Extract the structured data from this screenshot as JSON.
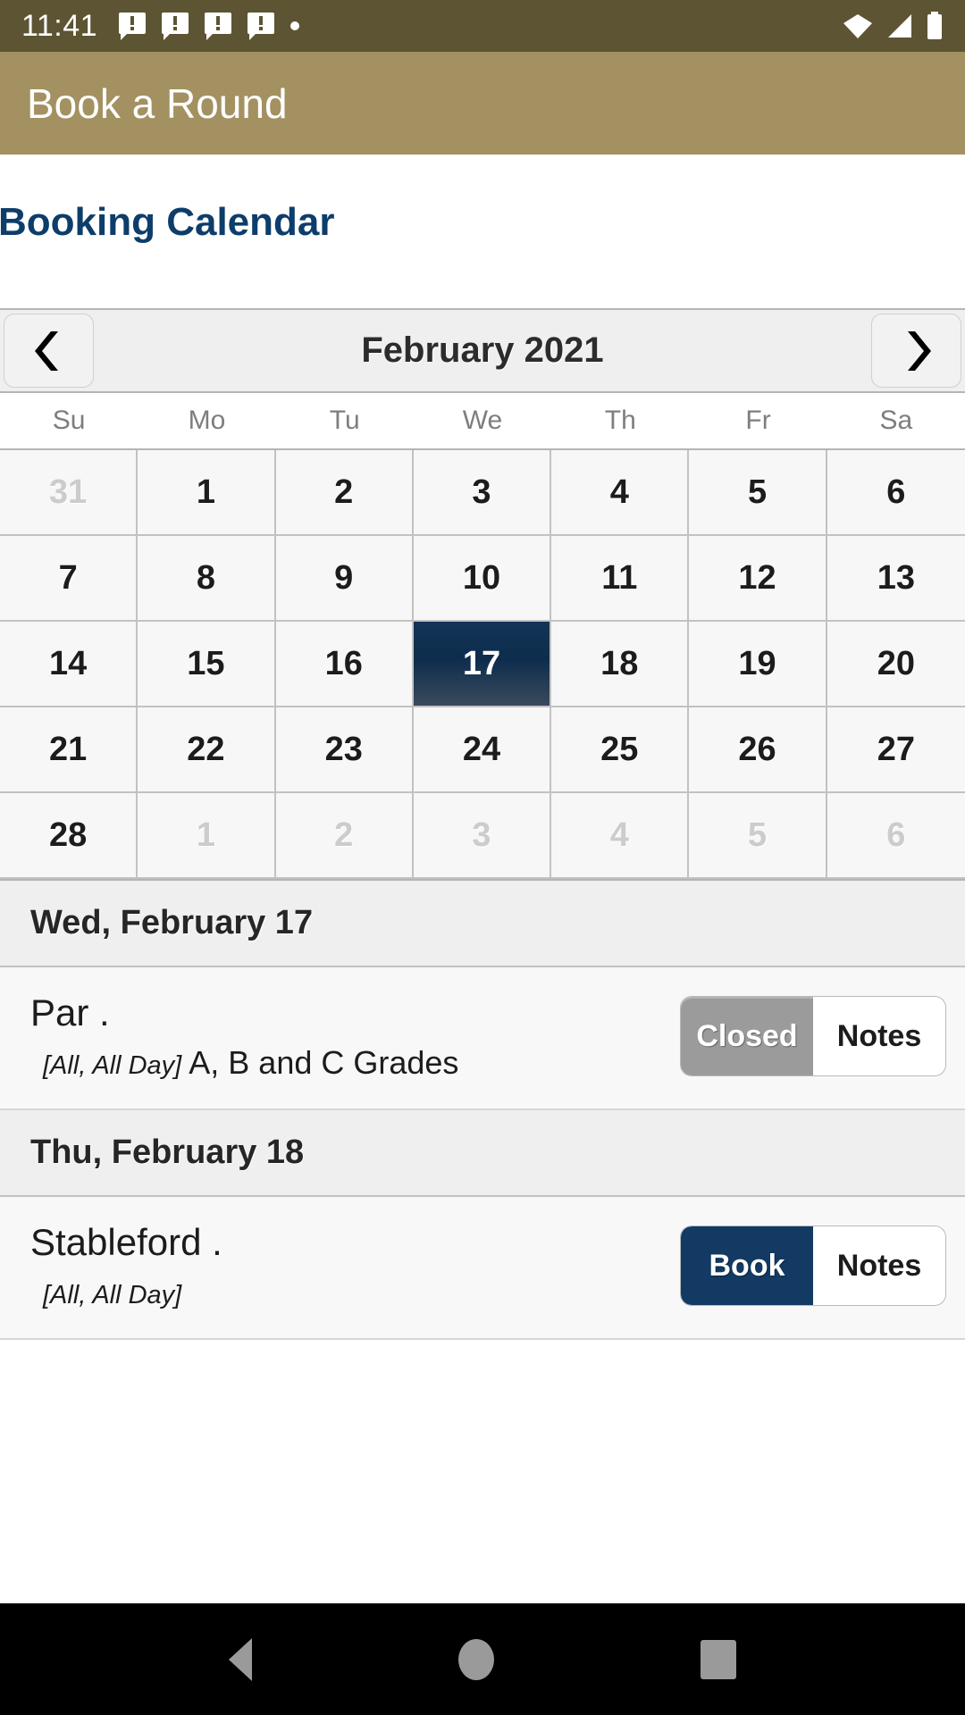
{
  "status_bar": {
    "time": "11:41",
    "left_icons": [
      "chat-alert-icon",
      "chat-alert-icon",
      "chat-alert-icon",
      "chat-alert-icon",
      "dot-icon"
    ],
    "right_icons": [
      "wifi-icon",
      "signal-icon",
      "battery-icon"
    ],
    "background": "#5c5433"
  },
  "app_bar": {
    "title": "Book a Round",
    "background": "#a39161"
  },
  "page": {
    "heading": "Booking Calendar",
    "heading_color": "#0d3d6b"
  },
  "calendar": {
    "prev_label": "‹",
    "next_label": "›",
    "title": "February 2021",
    "month": "February",
    "year": "2021",
    "day_headers": [
      "Su",
      "Mo",
      "Tu",
      "We",
      "Th",
      "Fr",
      "Sa"
    ],
    "selected_day": 17,
    "selected_color": "#123456",
    "weeks": [
      [
        {
          "d": "31",
          "muted": true
        },
        {
          "d": "1",
          "muted": false
        },
        {
          "d": "2",
          "muted": false
        },
        {
          "d": "3",
          "muted": false
        },
        {
          "d": "4",
          "muted": false
        },
        {
          "d": "5",
          "muted": false
        },
        {
          "d": "6",
          "muted": false
        }
      ],
      [
        {
          "d": "7",
          "muted": false
        },
        {
          "d": "8",
          "muted": false
        },
        {
          "d": "9",
          "muted": false
        },
        {
          "d": "10",
          "muted": false
        },
        {
          "d": "11",
          "muted": false
        },
        {
          "d": "12",
          "muted": false
        },
        {
          "d": "13",
          "muted": false
        }
      ],
      [
        {
          "d": "14",
          "muted": false
        },
        {
          "d": "15",
          "muted": false
        },
        {
          "d": "16",
          "muted": false
        },
        {
          "d": "17",
          "muted": false,
          "selected": true
        },
        {
          "d": "18",
          "muted": false
        },
        {
          "d": "19",
          "muted": false
        },
        {
          "d": "20",
          "muted": false
        }
      ],
      [
        {
          "d": "21",
          "muted": false
        },
        {
          "d": "22",
          "muted": false
        },
        {
          "d": "23",
          "muted": false
        },
        {
          "d": "24",
          "muted": false
        },
        {
          "d": "25",
          "muted": false
        },
        {
          "d": "26",
          "muted": false
        },
        {
          "d": "27",
          "muted": false
        }
      ],
      [
        {
          "d": "28",
          "muted": false
        },
        {
          "d": "1",
          "muted": true
        },
        {
          "d": "2",
          "muted": true
        },
        {
          "d": "3",
          "muted": true
        },
        {
          "d": "4",
          "muted": true
        },
        {
          "d": "5",
          "muted": true
        },
        {
          "d": "6",
          "muted": true
        }
      ]
    ]
  },
  "event_sections": [
    {
      "date_header": "Wed, February 17",
      "events": [
        {
          "title": "Par .",
          "time_bracket": "[All, All Day]",
          "detail": "A, B and C Grades",
          "action_label": "Closed",
          "action_state": "closed",
          "notes_label": "Notes"
        }
      ]
    },
    {
      "date_header": "Thu, February 18",
      "events": [
        {
          "title": "Stableford .",
          "time_bracket": "[All, All Day]",
          "detail": "",
          "action_label": "Book",
          "action_state": "book",
          "notes_label": "Notes"
        }
      ]
    }
  ],
  "nav_bar": {
    "items": [
      "back-icon",
      "home-icon",
      "recents-icon"
    ],
    "background": "#000000"
  }
}
